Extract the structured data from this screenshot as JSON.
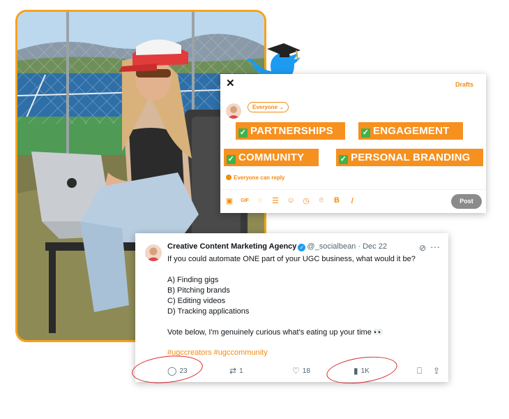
{
  "composer": {
    "close_icon": "close-icon",
    "drafts_label": "Drafts",
    "audience_label": "Everyone",
    "tags": [
      "PARTNERSHIPS",
      "ENGAGEMENT",
      "COMMUNITY",
      "PERSONAL BRANDING"
    ],
    "reply_setting": "Everyone can reply",
    "toolbar_icons": [
      "image-icon",
      "gif-icon",
      "grok-icon",
      "poll-icon",
      "emoji-icon",
      "schedule-icon",
      "location-icon",
      "bold-icon",
      "italic-icon"
    ],
    "post_label": "Post",
    "accent": "#f38b10",
    "tag_bg": "#f6901e",
    "check_color": "#3fb24b"
  },
  "tweet": {
    "name": "Creative Content Marketing Agency",
    "handle": "@_socialbean",
    "date": "· Dec 22",
    "question": "If you could automate ONE part of your UGC business, what would it be?",
    "options": [
      "A) Finding gigs",
      "B) Pitching brands",
      "C) Editing videos",
      "D) Tracking applications"
    ],
    "closing": "Vote below, I'm genuinely curious what's eating up your time 👀",
    "hashtags": [
      "#ugccreators",
      "#ugccommunity"
    ],
    "stats": {
      "replies": "23",
      "retweets": "1",
      "likes": "18",
      "views": "1K"
    }
  }
}
